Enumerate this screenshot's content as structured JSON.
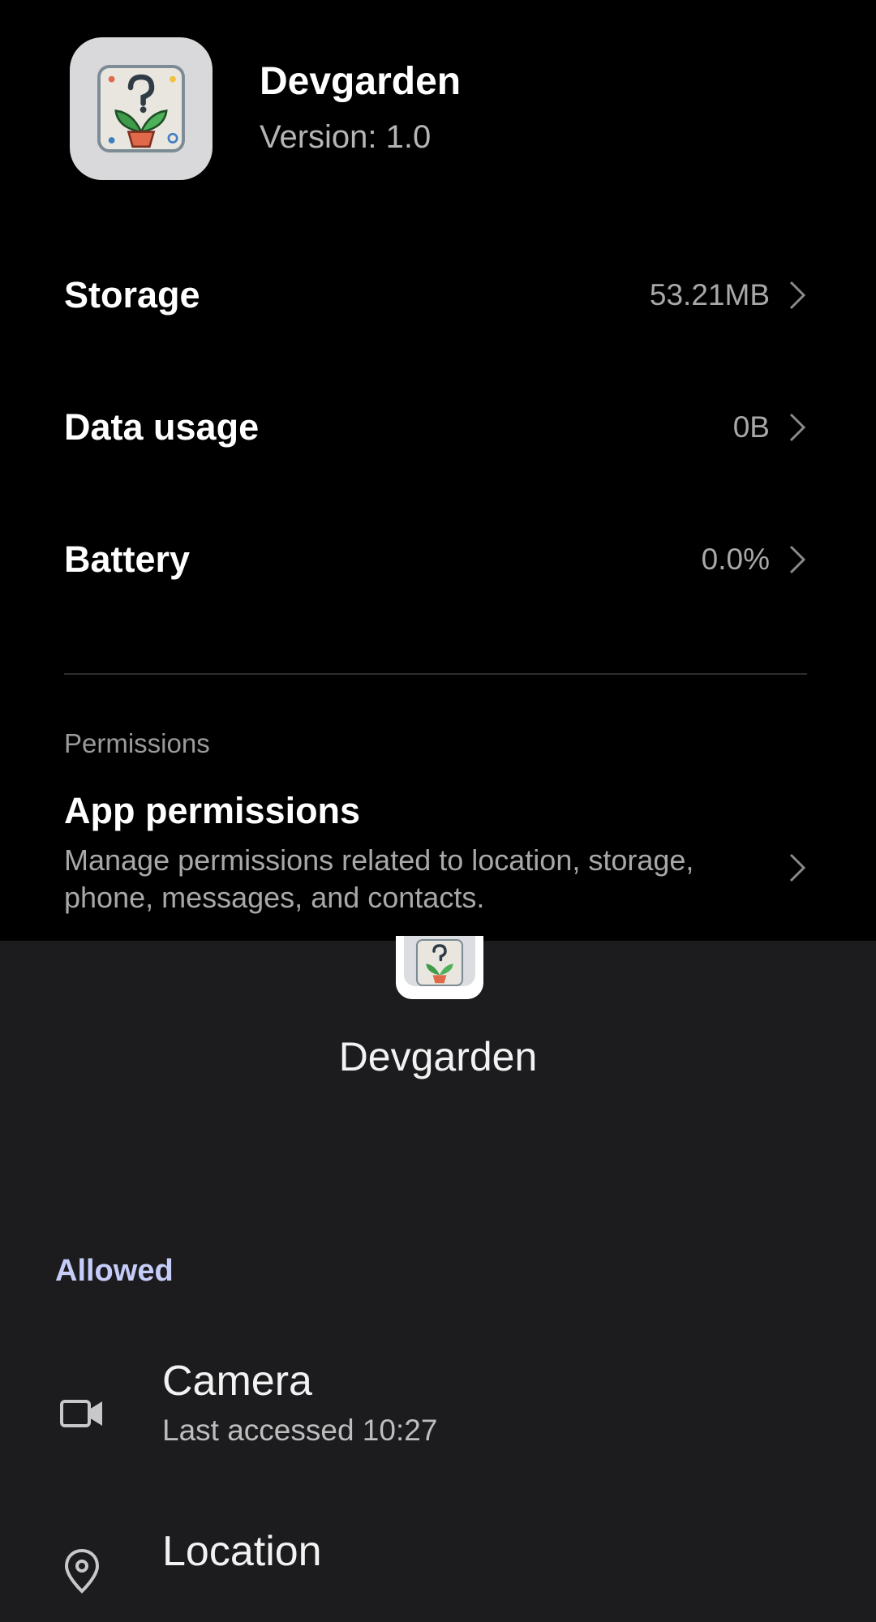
{
  "app": {
    "name": "Devgarden",
    "version": "Version: 1.0"
  },
  "info_rows": {
    "storage": {
      "label": "Storage",
      "value": "53.21MB"
    },
    "data_usage": {
      "label": "Data usage",
      "value": "0B"
    },
    "battery": {
      "label": "Battery",
      "value": "0.0%"
    }
  },
  "permissions_section": {
    "header": "Permissions",
    "title": "App permissions",
    "description": "Manage permissions related to location, storage, phone, messages, and contacts."
  },
  "sheet": {
    "title": "Devgarden",
    "allowed_header": "Allowed",
    "items": [
      {
        "name": "Camera",
        "sub": "Last accessed 10:27",
        "icon": "camera-icon"
      },
      {
        "name": "Location",
        "icon": "location-icon"
      }
    ]
  },
  "colors": {
    "background": "#000000",
    "sheet_background": "#1c1c1e",
    "accent": "#c5cdf8",
    "secondary_text": "#a8a8a8"
  }
}
